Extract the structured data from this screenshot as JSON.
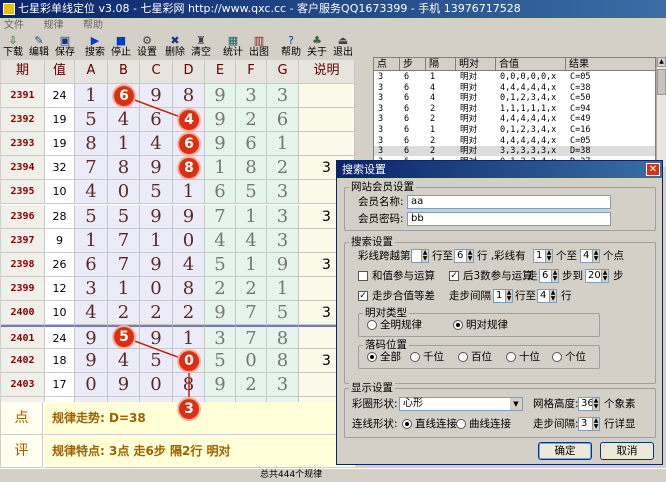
{
  "window": {
    "title": "七星彩单线定位 v3.08 - 七星彩网 http://www.qxc.cc - 客户服务QQ1673399 - 手机 13976717528"
  },
  "menu": [
    "文件",
    "规律",
    "帮助"
  ],
  "toolbar": [
    {
      "label": "下载",
      "icon": "download-icon"
    },
    {
      "label": "编辑",
      "icon": "edit-icon"
    },
    {
      "label": "保存",
      "icon": "save-icon"
    },
    {
      "label": "搜索",
      "icon": "play-icon"
    },
    {
      "label": "停止",
      "icon": "stop-icon"
    },
    {
      "label": "设置",
      "icon": "settings-icon"
    },
    {
      "label": "删除",
      "icon": "delete-icon"
    },
    {
      "label": "清空",
      "icon": "clear-icon"
    },
    {
      "label": "统计",
      "icon": "stats-icon"
    },
    {
      "label": "出图",
      "icon": "chart-icon"
    },
    {
      "label": "帮助",
      "icon": "help-icon"
    },
    {
      "label": "关于",
      "icon": "about-icon"
    },
    {
      "label": "退出",
      "icon": "exit-icon"
    }
  ],
  "grid": {
    "headers": [
      "期",
      "值",
      "A",
      "B",
      "C",
      "D",
      "E",
      "F",
      "G",
      "说明"
    ],
    "rows": [
      {
        "period": "2391",
        "value": "24",
        "d": [
          "1",
          "6",
          "9",
          "8",
          "9",
          "3",
          "3"
        ],
        "note": ""
      },
      {
        "period": "2392",
        "value": "19",
        "d": [
          "5",
          "4",
          "6",
          "4",
          "9",
          "2",
          "6"
        ],
        "note": ""
      },
      {
        "period": "2393",
        "value": "19",
        "d": [
          "8",
          "1",
          "4",
          "6",
          "9",
          "6",
          "1"
        ],
        "note": ""
      },
      {
        "period": "2394",
        "value": "32",
        "d": [
          "7",
          "8",
          "9",
          "8",
          "1",
          "8",
          "2"
        ],
        "note": "3"
      },
      {
        "period": "2395",
        "value": "10",
        "d": [
          "4",
          "0",
          "5",
          "1",
          "6",
          "5",
          "3"
        ],
        "note": ""
      },
      {
        "period": "2396",
        "value": "28",
        "d": [
          "5",
          "5",
          "9",
          "9",
          "7",
          "1",
          "3"
        ],
        "note": "3"
      },
      {
        "period": "2397",
        "value": "9",
        "d": [
          "1",
          "7",
          "1",
          "0",
          "4",
          "4",
          "3"
        ],
        "note": ""
      },
      {
        "period": "2398",
        "value": "26",
        "d": [
          "6",
          "7",
          "9",
          "4",
          "5",
          "1",
          "9"
        ],
        "note": "3"
      },
      {
        "period": "2399",
        "value": "12",
        "d": [
          "3",
          "1",
          "0",
          "8",
          "2",
          "2",
          "1"
        ],
        "note": ""
      },
      {
        "period": "2400",
        "value": "10",
        "d": [
          "4",
          "2",
          "2",
          "2",
          "9",
          "7",
          "5"
        ],
        "note": "3"
      },
      {
        "period": "2401",
        "value": "24",
        "d": [
          "9",
          "5",
          "9",
          "1",
          "3",
          "7",
          "8"
        ],
        "note": ""
      },
      {
        "period": "2402",
        "value": "18",
        "d": [
          "9",
          "4",
          "5",
          "0",
          "5",
          "0",
          "8"
        ],
        "note": "3"
      },
      {
        "period": "2403",
        "value": "17",
        "d": [
          "0",
          "9",
          "0",
          "8",
          "9",
          "2",
          "3"
        ],
        "note": ""
      },
      {
        "period": "",
        "value": "",
        "d": [
          "",
          "",
          "",
          "3",
          "",
          "",
          ""
        ],
        "note": "3"
      }
    ]
  },
  "bottom": {
    "label1": "点",
    "text1": "规律走势: D=38",
    "label2": "评",
    "text2": "规律特点: 3点 走6步 隔2行 明对"
  },
  "list": {
    "headers": [
      "点",
      "步",
      "隔",
      "明对",
      "合值",
      "结果"
    ],
    "rows": [
      [
        "3",
        "6",
        "1",
        "明对",
        "0,0,0,0,0,x",
        "C=05"
      ],
      [
        "3",
        "6",
        "4",
        "明对",
        "4,4,4,4,4,x",
        "C=38"
      ],
      [
        "3",
        "6",
        "4",
        "明对",
        "0,1,2,3,4,x",
        "C=50"
      ],
      [
        "3",
        "6",
        "2",
        "明对",
        "1,1,1,1,1,x",
        "C=94"
      ],
      [
        "3",
        "6",
        "2",
        "明对",
        "4,4,4,4,4,x",
        "C=49"
      ],
      [
        "3",
        "6",
        "1",
        "明对",
        "0,1,2,3,4,x",
        "C=16"
      ],
      [
        "3",
        "6",
        "2",
        "明对",
        "4,4,4,4,4,x",
        "C=05"
      ],
      [
        "3",
        "6",
        "2",
        "明对",
        "3,3,3,3,3,x",
        "D=38"
      ],
      [
        "3",
        "6",
        "4",
        "明对",
        "0,1,2,3,4,x",
        "D=27"
      ]
    ],
    "selected_index": 7
  },
  "status": {
    "text": "总共444个规律"
  },
  "dialog": {
    "title": "搜索设置",
    "close_symbol": "✕",
    "member_group": "网站会员设置",
    "member_name_label": "会员名称:",
    "member_name_value": "aa",
    "member_pwd_label": "会员密码:",
    "member_pwd_value": "bb",
    "search_group": "搜索设置",
    "skip_label": "彩线跨越第",
    "skip_from": "",
    "row_to_label": "行至",
    "skip_to": "6",
    "row_label": "行 ,彩线有",
    "pts_from": "1",
    "pts_to_label": "个至",
    "pts_to": "4",
    "pts_label": "个点",
    "opt_sum": "和值参与运算",
    "opt_tail": "后3数参与运算",
    "step_label": "走",
    "step_from": "6",
    "step_to_label": "步到",
    "step_to": "20",
    "step_unit": "步",
    "opt_equal": "走步合值等差",
    "gap_label": "走步间隔",
    "gap_from": "1",
    "gap_to_label": "行至",
    "gap_to": "4",
    "gap_unit": "行",
    "pair_group": "明对类型",
    "pair_all": "全明规律",
    "pair_mingdui": "明对规律",
    "pos_group": "落码位置",
    "pos_opts": [
      "全部",
      "千位",
      "百位",
      "十位",
      "个位"
    ],
    "display_group": "显示设置",
    "ball_shape_label": "彩圈形状:",
    "ball_shape_value": "心形",
    "grid_h_label": "网格高度:",
    "grid_h_value": "36",
    "grid_h_unit": "个象素",
    "line_shape_label": "连线形状:",
    "line_straight": "直线连接",
    "line_curve": "曲线连接",
    "step_gap_label": "走步间隔:",
    "step_gap_value": "3",
    "step_gap_unit": "行详显",
    "ok": "确定",
    "cancel": "取消"
  },
  "colors": {
    "ball": "#d83010",
    "title_start": "#0a246a",
    "title_end": "#3a6ea5"
  }
}
